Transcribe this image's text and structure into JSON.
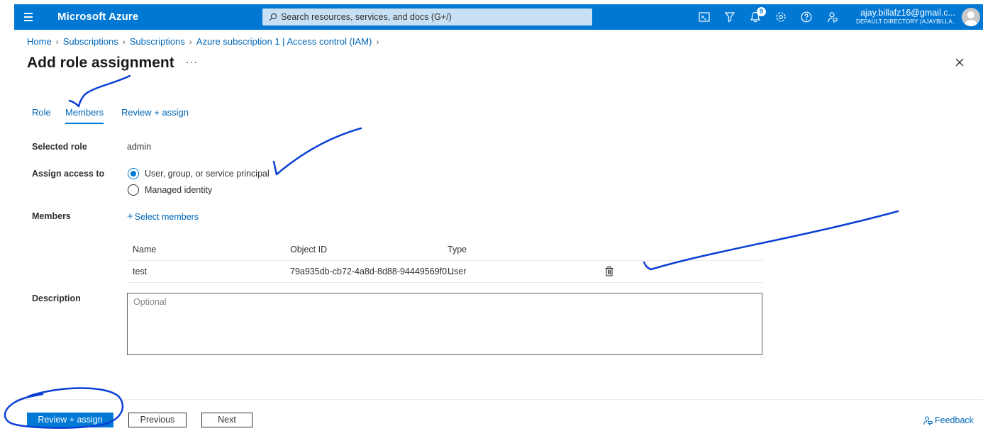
{
  "topbar": {
    "brand": "Microsoft Azure",
    "search_placeholder": "Search resources, services, and docs (G+/)",
    "notifications_count": "9",
    "account_name": "ajay.billafz16@gmail.c...",
    "account_directory": "DEFAULT DIRECTORY (AJAYBILLA..."
  },
  "breadcrumb": {
    "items": [
      "Home",
      "Subscriptions",
      "Subscriptions",
      "Azure subscription 1 | Access control (IAM)"
    ]
  },
  "page": {
    "title": "Add role assignment",
    "more": "···"
  },
  "tabs": [
    {
      "label": "Role",
      "active": false
    },
    {
      "label": "Members",
      "active": true
    },
    {
      "label": "Review + assign",
      "active": false
    }
  ],
  "form": {
    "selected_role_label": "Selected role",
    "selected_role_value": "admin",
    "assign_access_label": "Assign access to",
    "access_options": [
      "User, group, or service principal",
      "Managed identity"
    ],
    "access_selected": "User, group, or service principal",
    "members_label": "Members",
    "select_members_plus": "+",
    "select_members": "Select members",
    "description_label": "Description",
    "description_placeholder": "Optional"
  },
  "members_table": {
    "columns": [
      "Name",
      "Object ID",
      "Type"
    ],
    "rows": [
      {
        "name": "test",
        "object_id": "79a935db-cb72-4a8d-8d88-94449569f0...",
        "type": "User"
      }
    ]
  },
  "footer": {
    "review_assign": "Review + assign",
    "previous": "Previous",
    "next": "Next",
    "feedback": "Feedback"
  },
  "colors": {
    "accent": "#0078d4",
    "annotation": "#0a3fd6"
  }
}
